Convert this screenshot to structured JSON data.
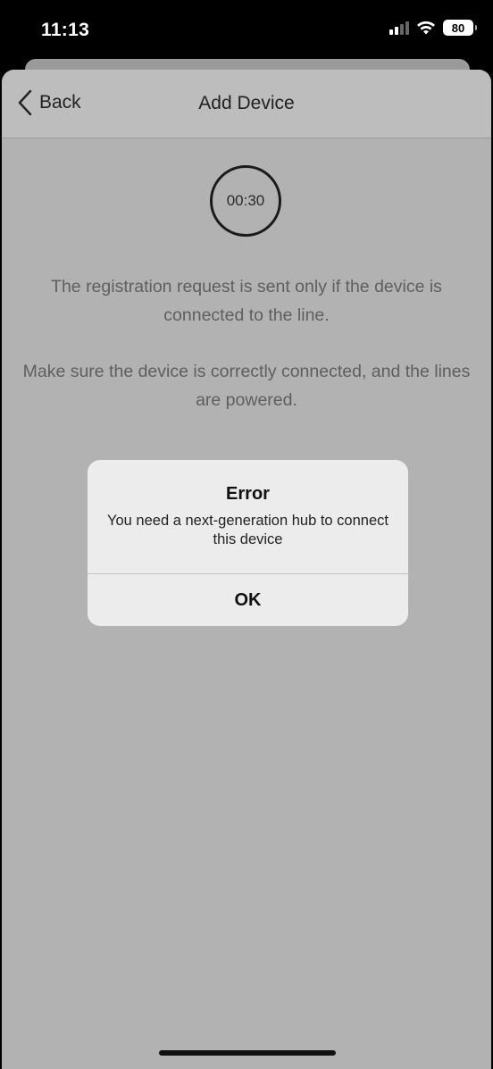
{
  "status_bar": {
    "time": "11:13",
    "battery": "80",
    "icons": [
      "cellular-signal-icon",
      "wifi-icon",
      "battery-icon"
    ]
  },
  "nav": {
    "back_label": "Back",
    "title": "Add Device",
    "back_icon": "chevron-left-icon"
  },
  "timer": {
    "value": "00:30"
  },
  "info": {
    "line1": "The registration request is sent only if the device is connected to the line.",
    "line2": "Make sure the device is correctly connected, and the lines are powered."
  },
  "alert": {
    "title": "Error",
    "message": "You need a next-generation hub to connect this device",
    "ok_label": "OK"
  },
  "colors": {
    "sheet_dimmed": "#b2b2b2",
    "alert_background": "#ececec",
    "status_bar": "#000000"
  }
}
